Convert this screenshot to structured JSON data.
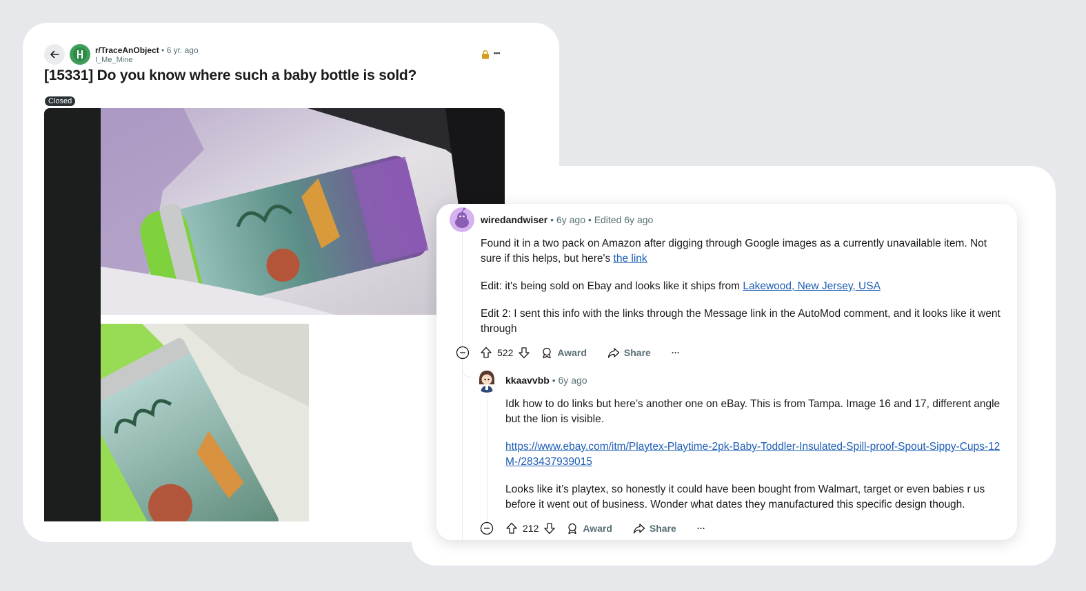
{
  "post": {
    "subreddit": "r/TraceAnObject",
    "separator": "•",
    "age": "6 yr. ago",
    "author": "I_Me_Mine",
    "title": "[15331] Do you know where such a baby bottle is sold?",
    "flair": "Closed",
    "more_label": "•••"
  },
  "comments": [
    {
      "author": "wiredandwiser",
      "age": "6y ago",
      "edited": "Edited 6y ago",
      "body": {
        "p1_text": "Found it in a two pack on Amazon after digging through Google images as a currently unavailable item. Not sure if this helps, but here's ",
        "p1_link": "the link",
        "p2_text": "Edit: it's being sold on Ebay and looks like it ships from ",
        "p2_link": "Lakewood, New Jersey, USA",
        "p3_text": "Edit 2: I sent this info with the links through the Message link in the AutoMod comment, and it looks like it went through"
      },
      "votes": "522",
      "award_label": "Award",
      "share_label": "Share",
      "more_label": "···"
    },
    {
      "author": "kkaavvbb",
      "age": "6y ago",
      "body": {
        "p1_text": "Idk how to do links but here’s another one on eBay. This is from Tampa. Image 16 and 17, different angle but the lion is visible.",
        "p2_link": "https://www.ebay.com/itm/Playtex-Playtime-2pk-Baby-Toddler-Insulated-Spill-proof-Spout-Sippy-Cups-12M-/283437939015",
        "p3_text": "Looks like it’s playtex, so honestly it could have been bought from Walmart, target or even babies r us before it went out of business. Wonder what dates they manufactured this specific design though."
      },
      "votes": "212",
      "award_label": "Award",
      "share_label": "Share",
      "more_label": "···"
    }
  ],
  "colors": {
    "accent_link": "#1d5db4",
    "meta_gray": "#576f76",
    "background": "#e6e8eb"
  }
}
